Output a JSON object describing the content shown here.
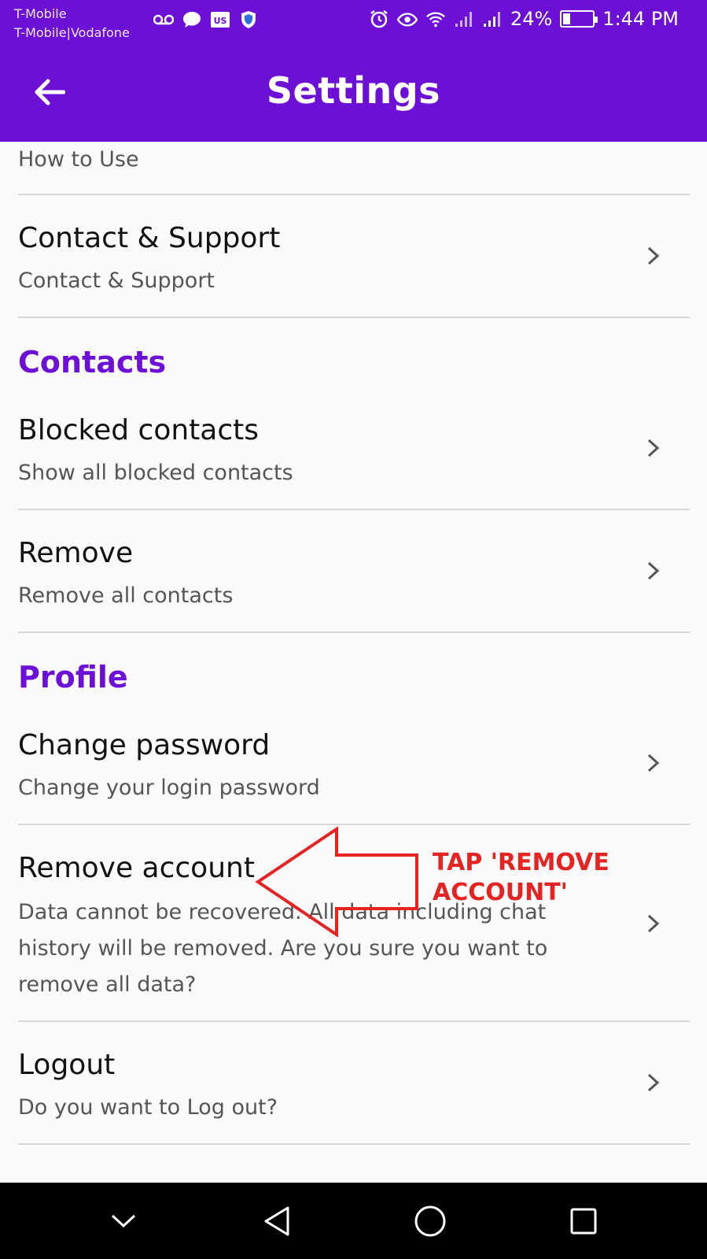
{
  "status": {
    "carrier_1": "T-Mobile",
    "carrier_2": "T-Mobile|Vodafone",
    "battery": "24%",
    "battery_level": 0.24,
    "time": "1:44 PM",
    "left_icons": [
      "voicemail-icon",
      "chat-bubble-icon",
      "us-flag-icon",
      "shield-icon"
    ],
    "right_icons": [
      "alarm-icon",
      "eye-icon",
      "wifi-icon",
      "signal-icon",
      "signal-roaming-icon"
    ]
  },
  "appbar": {
    "title": "Settings",
    "back_icon": "arrow-left-icon"
  },
  "colors": {
    "brand": "#6d10d6",
    "annotation": "#e42323"
  },
  "items": {
    "how_to_use": {
      "title": "How to Use"
    },
    "contact_support": {
      "title": "Contact & Support",
      "subtitle": "Contact & Support"
    },
    "blocked_contacts": {
      "title": "Blocked contacts",
      "subtitle": "Show all blocked contacts"
    },
    "remove": {
      "title": "Remove",
      "subtitle": "Remove all contacts"
    },
    "change_password": {
      "title": "Change password",
      "subtitle": "Change your login password"
    },
    "remove_account": {
      "title": "Remove account",
      "subtitle": "Data cannot be recovered. All data including chat history will be removed. Are you sure you want to remove all data?"
    },
    "logout": {
      "title": "Logout",
      "subtitle": "Do you want to Log out?"
    }
  },
  "sections": {
    "contacts": "Contacts",
    "profile": "Profile"
  },
  "annotation": {
    "line1": "TAP 'REMOVE",
    "line2": "ACCOUNT'"
  },
  "navbar": {
    "icons": [
      "chevron-down-icon",
      "back-triangle-icon",
      "home-circle-icon",
      "recents-square-icon"
    ]
  }
}
